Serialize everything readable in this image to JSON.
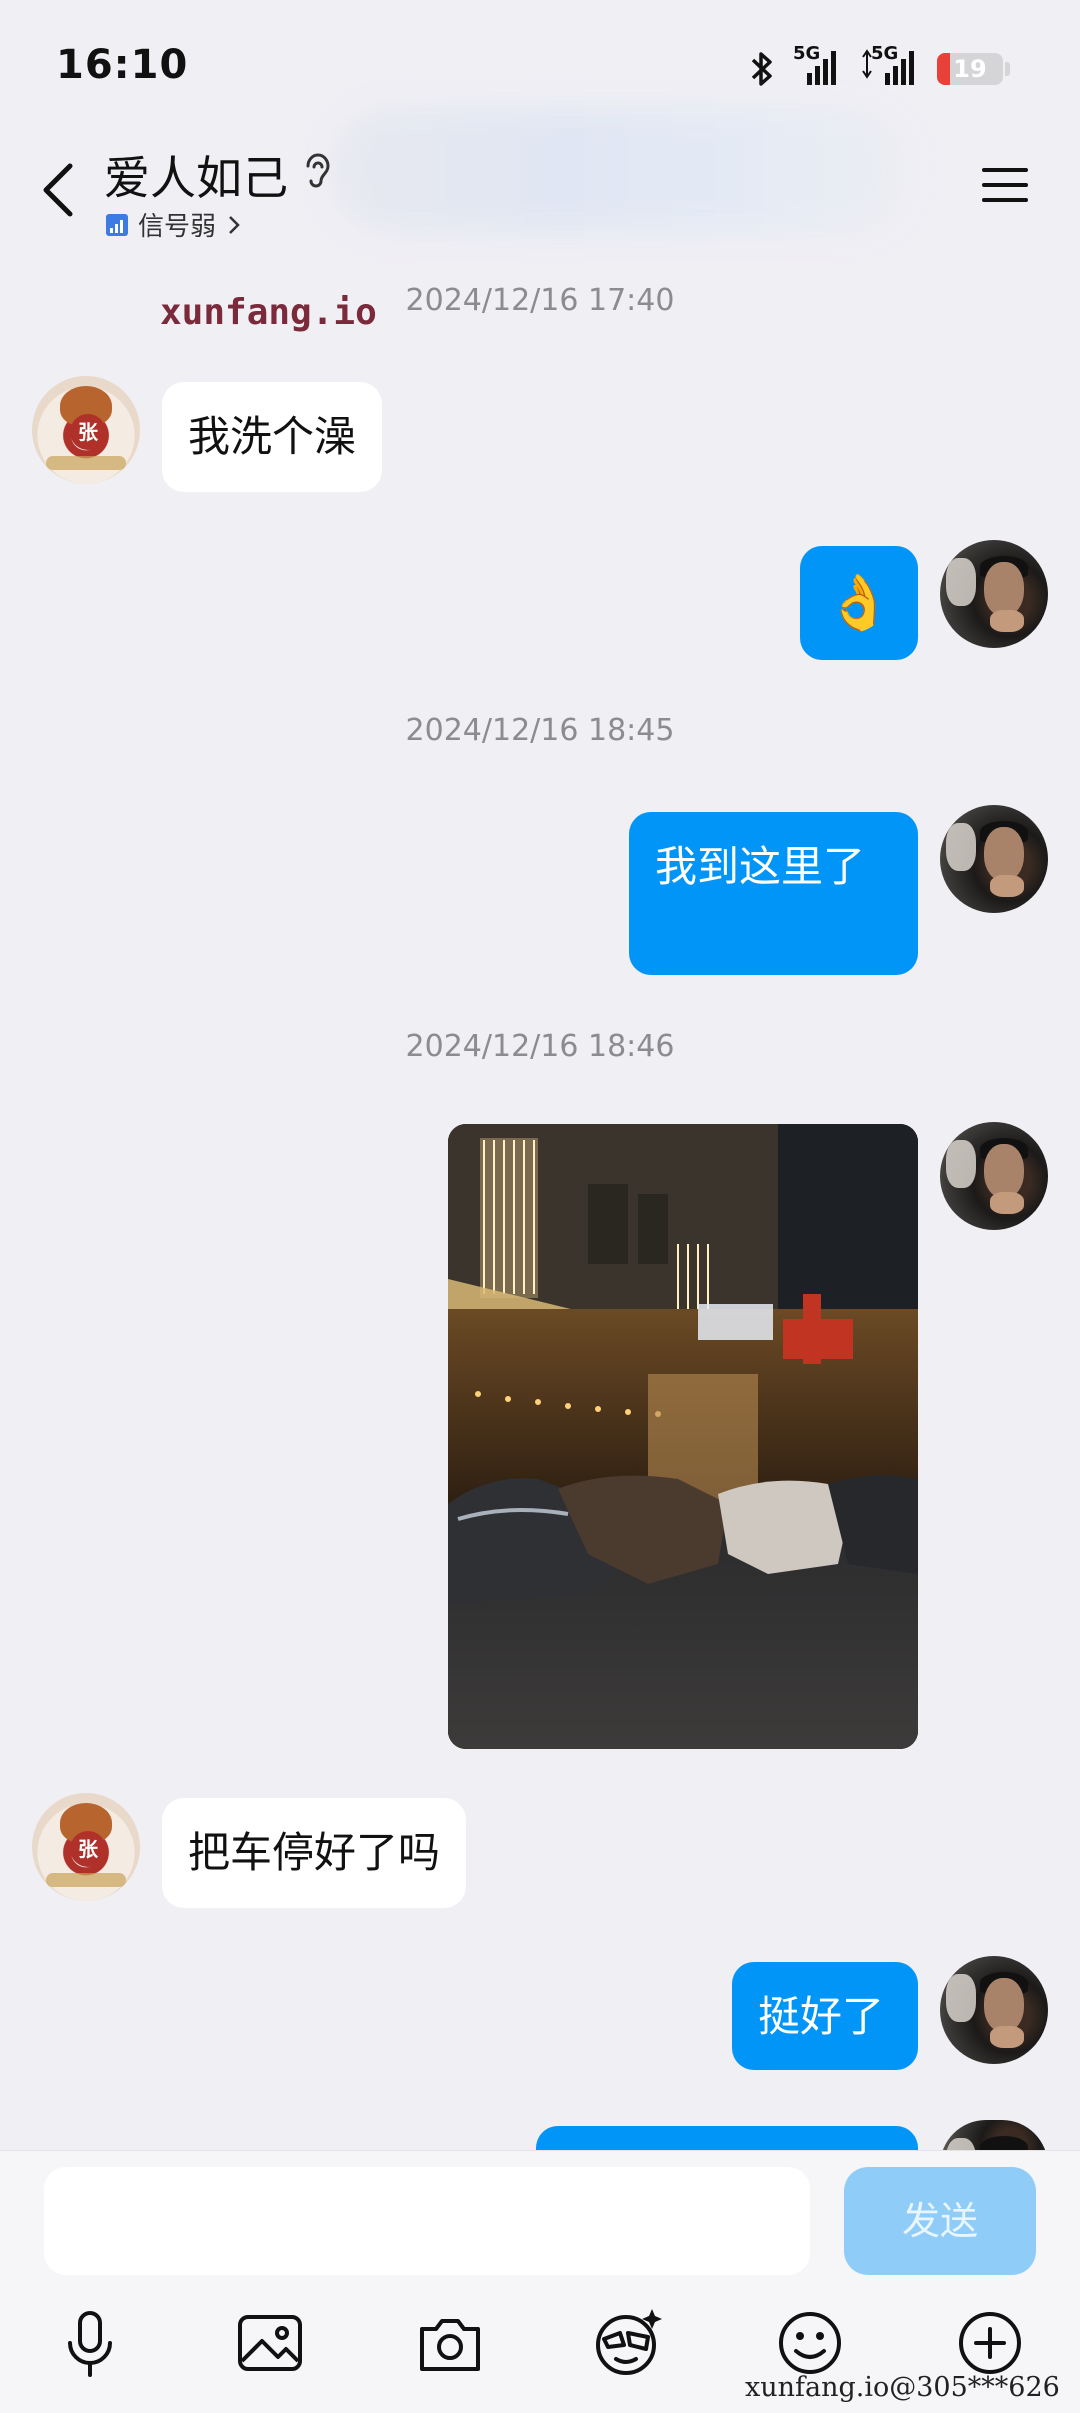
{
  "status_bar": {
    "time": "16:10",
    "network_1": "5G",
    "network_2": "5G",
    "battery": "19",
    "battery_level": 0.19,
    "battery_color": "#e8413a",
    "icons": [
      "bluetooth-icon",
      "signal-icon",
      "signal-icon",
      "battery-icon"
    ]
  },
  "header": {
    "title": "爱人如己",
    "signal_text": "信号弱",
    "icons": [
      "back-icon",
      "ear-icon",
      "menu-icon"
    ]
  },
  "watermark": {
    "top": "xunfang.io",
    "bottom": "xunfang.io@305***626"
  },
  "messages": [
    {
      "type": "timestamp",
      "text": "2024/12/16 17:40"
    },
    {
      "type": "text",
      "side": "left",
      "text": "我洗个澡"
    },
    {
      "type": "emoji",
      "side": "right",
      "text": "👌"
    },
    {
      "type": "timestamp",
      "text": "2024/12/16 18:45"
    },
    {
      "type": "text",
      "side": "right",
      "text": "我到这里了"
    },
    {
      "type": "timestamp",
      "text": "2024/12/16 18:46"
    },
    {
      "type": "image",
      "side": "right"
    },
    {
      "type": "text",
      "side": "left",
      "text": "把车停好了吗"
    },
    {
      "type": "text",
      "side": "right",
      "text": "挺好了"
    }
  ],
  "avatar_left_badge": "张",
  "input": {
    "placeholder": "",
    "value": ""
  },
  "send_label": "发送",
  "toolbar_icons": [
    "microphone-icon",
    "image-icon",
    "camera-icon",
    "sticker-icon",
    "emoji-icon",
    "plus-icon"
  ],
  "colors": {
    "accent": "#0095f6",
    "send_disabled": "#8fcdf8",
    "background": "#f0eff4"
  }
}
